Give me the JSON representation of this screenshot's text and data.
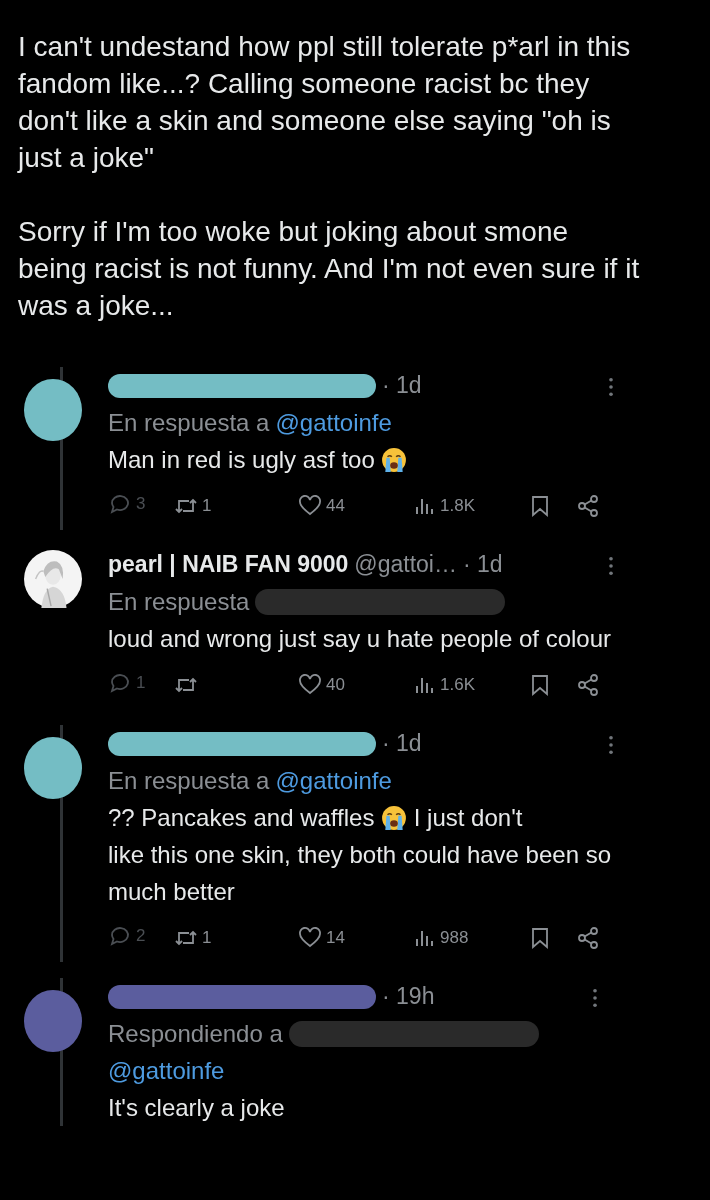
{
  "post": {
    "paragraphs": [
      "I can't undestand how ppl still tolerate p*arl in this fandom like...? Calling someone racist bc they don't like a skin and someone else saying \"oh is just a joke\"",
      "Sorry if I'm too woke but joking about smone being racist is not funny. And I'm not even sure if it was a joke..."
    ]
  },
  "replies": [
    {
      "connected": true,
      "avatar": {
        "kind": "redacted",
        "color": "#74bdc4"
      },
      "name_redaction": {
        "color": "#74bdc4"
      },
      "time": "· 1d",
      "reply_to": [
        {
          "kind": "label",
          "text": "En respuesta a"
        },
        {
          "kind": "mention",
          "text": "@gattoinfe"
        }
      ],
      "text": [
        {
          "kind": "text",
          "text": "Man in red is ugly asf too"
        },
        {
          "kind": "emoji"
        }
      ],
      "actions": [
        {
          "kind": "reply",
          "count": "3"
        },
        {
          "kind": "retweet",
          "count": "1"
        },
        {
          "kind": "like",
          "count": "44"
        },
        {
          "kind": "views",
          "count": "1.8K"
        },
        {
          "kind": "bookmark"
        },
        {
          "kind": "share"
        }
      ]
    },
    {
      "connected": false,
      "avatar": {
        "kind": "picture"
      },
      "name": "pearl | NAIB FAN 9000",
      "handle": "@gattoi…",
      "time": "· 1d",
      "reply_to": [
        {
          "kind": "label",
          "text": "En respuesta"
        },
        {
          "kind": "redaction"
        }
      ],
      "text": [
        {
          "kind": "text",
          "text": "loud and wrong just say u hate people of colour"
        }
      ],
      "actions": [
        {
          "kind": "reply",
          "count": "1"
        },
        {
          "kind": "retweet"
        },
        {
          "kind": "like",
          "count": "40"
        },
        {
          "kind": "views",
          "count": "1.6K"
        },
        {
          "kind": "bookmark"
        },
        {
          "kind": "share"
        }
      ]
    },
    {
      "connected": true,
      "avatar": {
        "kind": "redacted",
        "color": "#74bdc4"
      },
      "name_redaction": {
        "color": "#74bdc4"
      },
      "time": "· 1d",
      "reply_to": [
        {
          "kind": "label",
          "text": "En respuesta a"
        },
        {
          "kind": "mention",
          "text": "@gattoinfe"
        }
      ],
      "text": [
        {
          "kind": "text",
          "text": "?? Pancakes and waffles"
        },
        {
          "kind": "emoji"
        },
        {
          "kind": "text",
          "text": "I just don't"
        },
        {
          "kind": "line",
          "text": "like this one skin, they both could have been so much better"
        }
      ],
      "actions": [
        {
          "kind": "reply",
          "count": "2"
        },
        {
          "kind": "retweet",
          "count": "1"
        },
        {
          "kind": "like",
          "count": "14"
        },
        {
          "kind": "views",
          "count": "988"
        },
        {
          "kind": "bookmark"
        },
        {
          "kind": "share"
        }
      ]
    },
    {
      "connected": true,
      "avatar": {
        "kind": "redacted",
        "color": "#5b5d9e"
      },
      "name_redaction": {
        "color": "#5b5d9e"
      },
      "time": "· 19h",
      "reply_to": [
        {
          "kind": "label",
          "text": "Respondiendo a"
        },
        {
          "kind": "redaction"
        },
        {
          "kind": "mention",
          "text": "@gattoinfe"
        }
      ],
      "text": [
        {
          "kind": "text",
          "text": "It's clearly a joke"
        }
      ]
    }
  ]
}
